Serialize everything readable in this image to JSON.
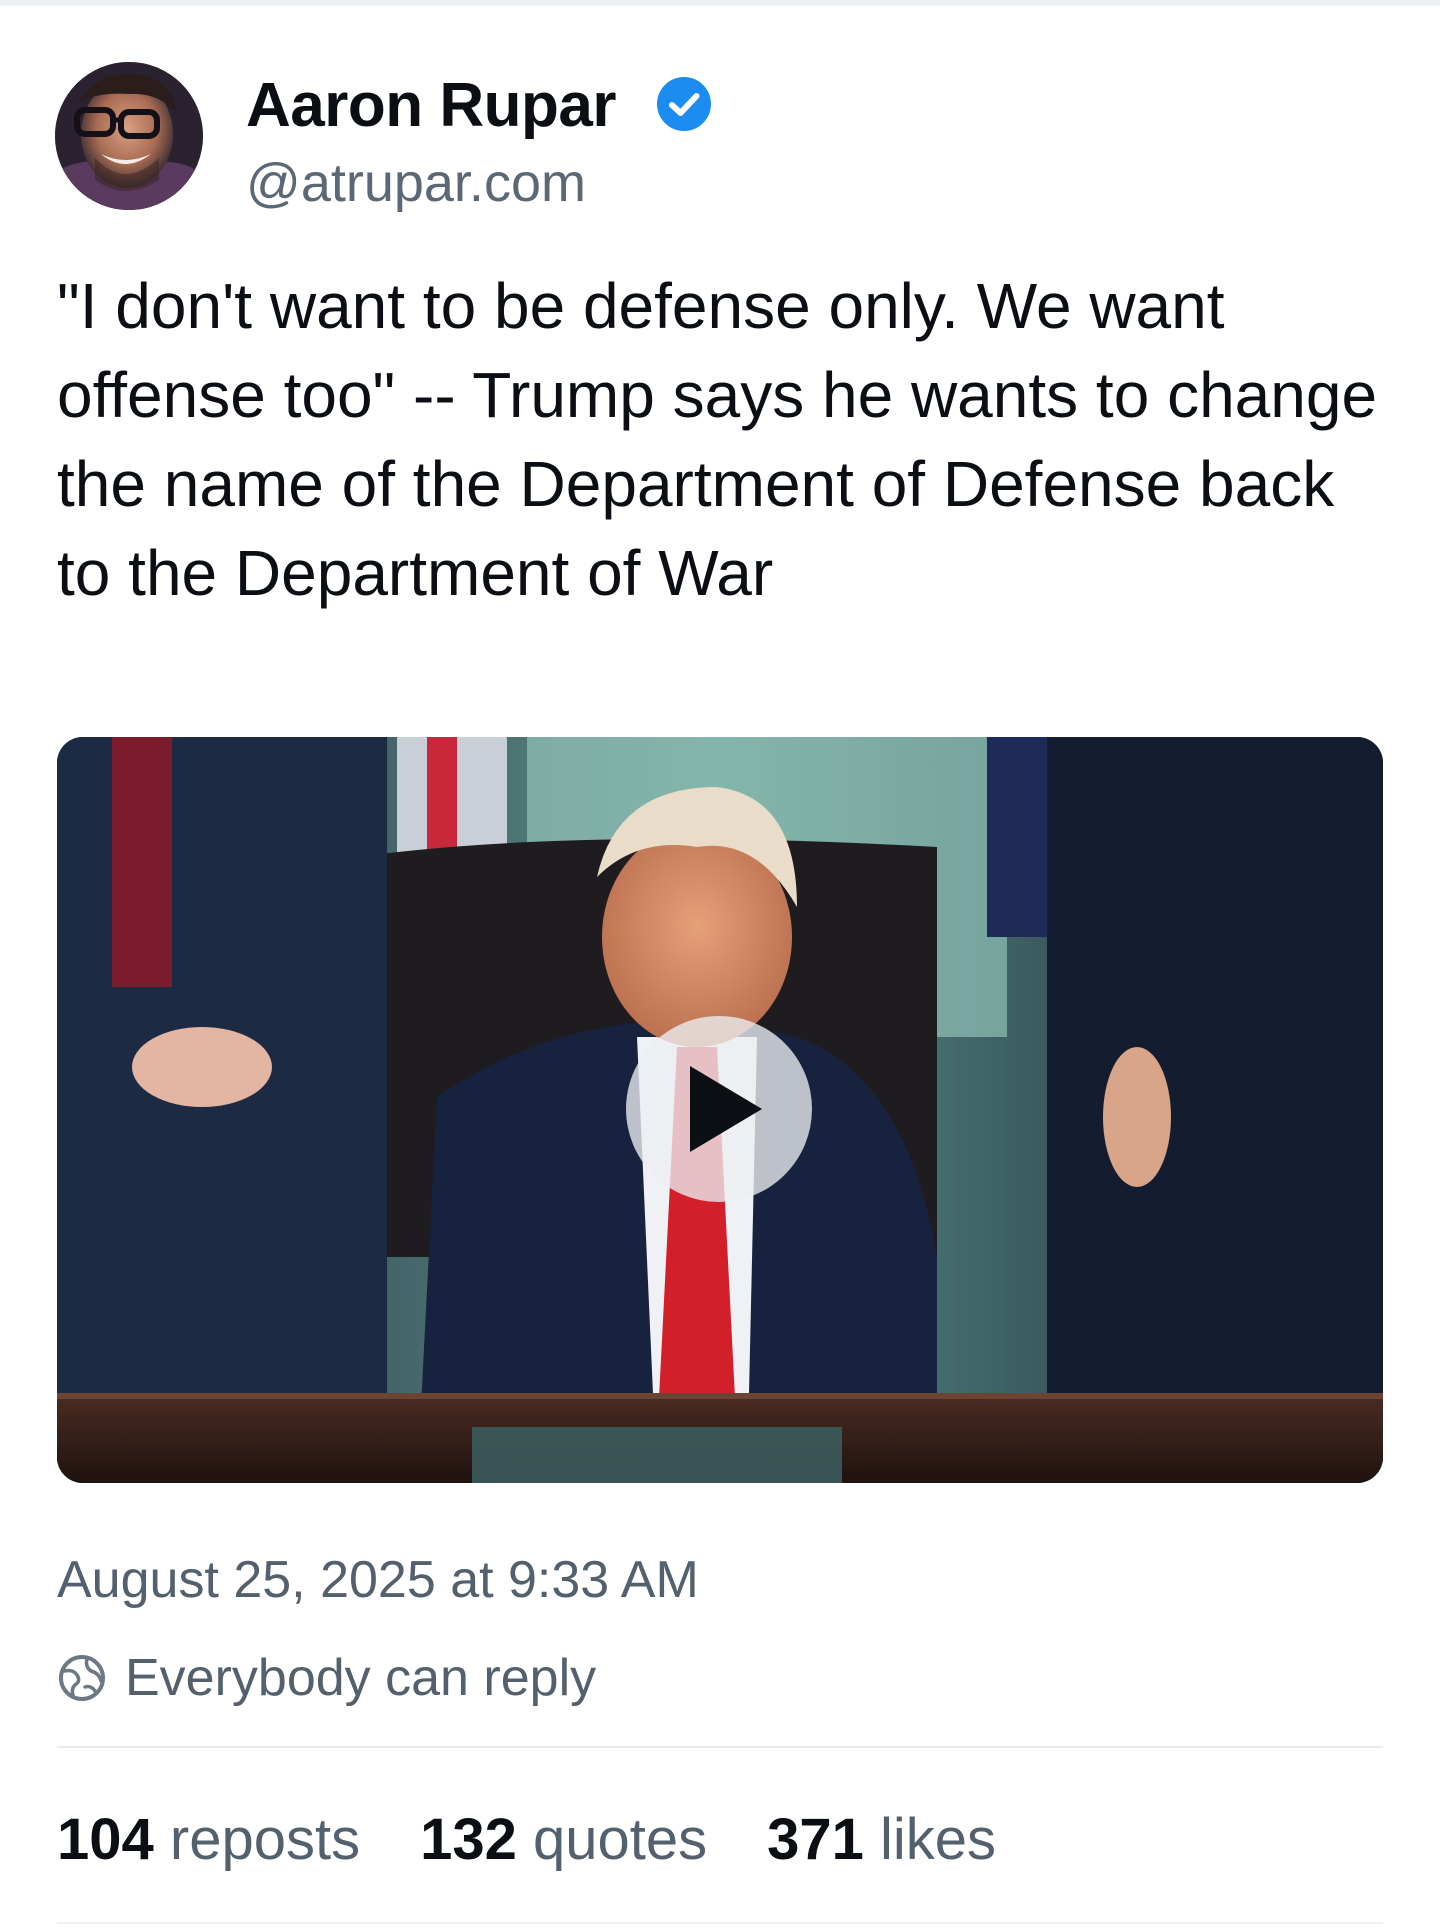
{
  "post": {
    "author": {
      "display_name": "Aaron Rupar",
      "handle": "@atrupar.com",
      "verified": true,
      "verified_color": "#1d8cf0"
    },
    "text": "\"I don't want to be defense only. We want offense too\" -- Trump says he wants to change the name of the Department of Defense back to the Department of War",
    "media": {
      "type": "video",
      "play_icon": "play-icon"
    },
    "timestamp": "August 25, 2025 at 9:33 AM",
    "reply_setting": {
      "icon": "globe-icon",
      "label": "Everybody can reply"
    },
    "stats": {
      "reposts": {
        "count": "104",
        "label": "reposts"
      },
      "quotes": {
        "count": "132",
        "label": "quotes"
      },
      "likes": {
        "count": "371",
        "label": "likes"
      }
    }
  },
  "colors": {
    "text_primary": "#0b0f14",
    "text_secondary": "#53606d",
    "accent": "#1d8cf0",
    "divider": "#e6e9ed"
  }
}
